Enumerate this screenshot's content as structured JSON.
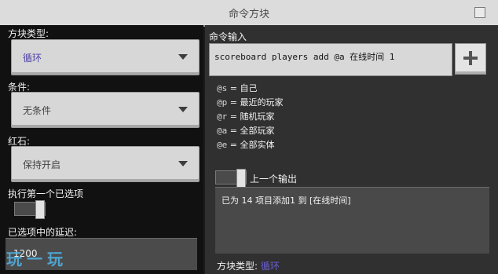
{
  "window": {
    "title": "命令方块"
  },
  "left": {
    "block_type": {
      "label": "方块类型:",
      "value": "循环"
    },
    "condition": {
      "label": "条件:",
      "value": "无条件"
    },
    "redstone": {
      "label": "红石:",
      "value": "保持开启"
    },
    "execute_first": {
      "label": "执行第一个已选项"
    },
    "delay": {
      "label": "已选项中的延迟:",
      "value": "1200"
    }
  },
  "right": {
    "command_input_label": "命令输入",
    "command_text": "scoreboard players add @a 在线时间 1",
    "add_button_label": "+",
    "selectors": [
      {
        "code": "@s",
        "sep": " = ",
        "desc": "自己"
      },
      {
        "code": "@p",
        "sep": " = ",
        "desc": "最近的玩家"
      },
      {
        "code": "@r",
        "sep": " = ",
        "desc": "随机玩家"
      },
      {
        "code": "@a",
        "sep": " = ",
        "desc": "全部玩家"
      },
      {
        "code": "@e",
        "sep": " = ",
        "desc": "全部实体"
      }
    ],
    "previous_output_label": "上一个输出",
    "output_text": "已为 14 项目添加1 到 [在线时间]",
    "block_type_footer": {
      "label": "方块类型:",
      "value": "循环"
    }
  },
  "watermark": "玩一玩",
  "colors": {
    "accent_text": "#4b3fa6",
    "accent_footer": "#6b5fd6",
    "panel_dark": "#111111",
    "panel_mid": "#303030"
  }
}
